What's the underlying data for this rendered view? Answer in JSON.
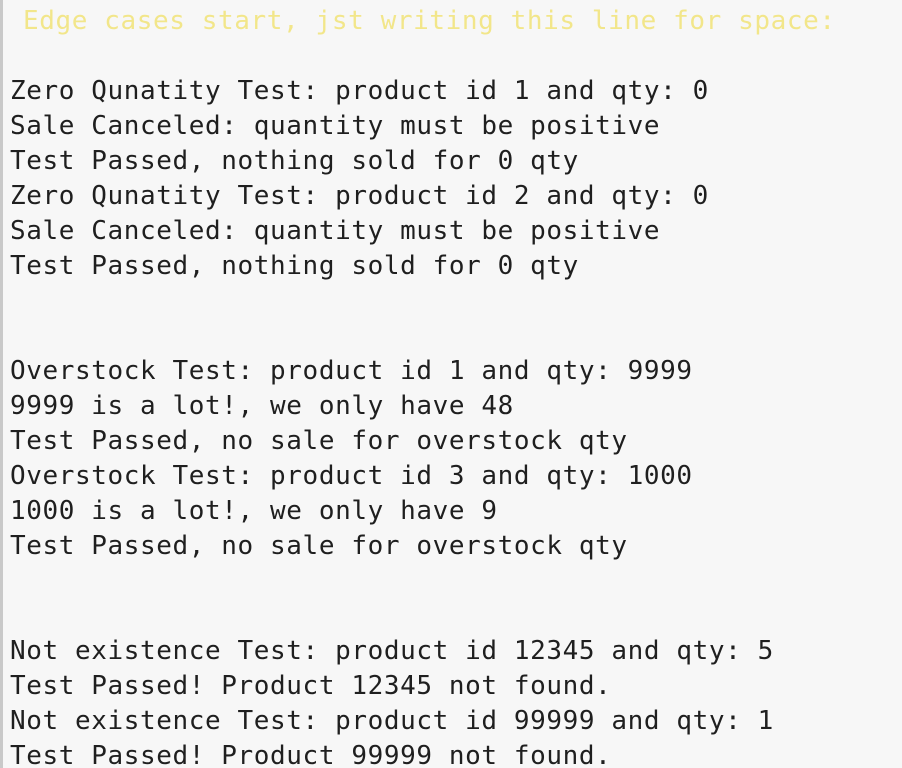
{
  "console": {
    "header": "Edge cases start, jst writing this line for space:",
    "lines": [
      "Zero Qunatity Test: product id 1 and qty: 0",
      "Sale Canceled: quantity must be positive",
      "Test Passed, nothing sold for 0 qty",
      "Zero Qunatity Test: product id 2 and qty: 0",
      "Sale Canceled: quantity must be positive",
      "Test Passed, nothing sold for 0 qty",
      "Overstock Test: product id 1 and qty: 9999",
      "9999 is a lot!, we only have 48",
      "Test Passed, no sale for overstock qty",
      "Overstock Test: product id 3 and qty: 1000",
      "1000 is a lot!, we only have 9",
      "Test Passed, no sale for overstock qty",
      "Not existence Test: product id 12345 and qty: 5",
      "Test Passed! Product 12345 not found.",
      "Not existence Test: product id 99999 and qty: 1",
      "Test Passed! Product 99999 not found."
    ]
  },
  "colors": {
    "header_text": "#f2e68a",
    "output_text": "#1f1f1f",
    "background": "#f7f7f7"
  }
}
